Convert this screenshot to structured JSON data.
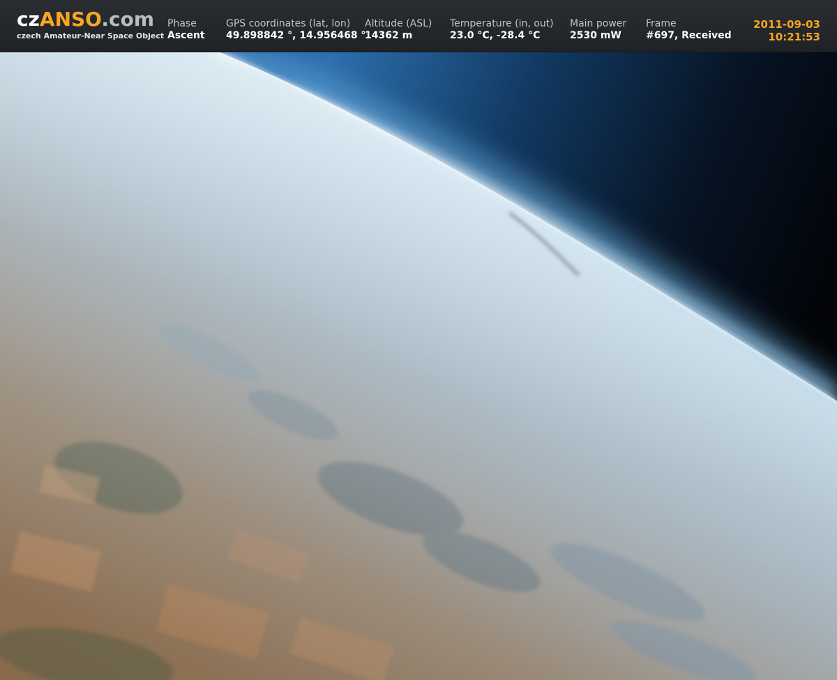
{
  "logo": {
    "part1": "cz",
    "part2": "ANSO",
    "part3": ".com",
    "subtitle": "czech Amateur-Near Space Object"
  },
  "telemetry": {
    "phase": {
      "label": "Phase",
      "value": "Ascent"
    },
    "gps": {
      "label": "GPS coordinates (lat, lon)",
      "value": "49.898842 °, 14.956468 °"
    },
    "altitude": {
      "label": "Altitude (ASL)",
      "value": "14362 m"
    },
    "temperature": {
      "label": "Temperature (in, out)",
      "value": "23.0 °C, -28.4 °C"
    },
    "power": {
      "label": "Main power",
      "value": "2530 mW"
    },
    "frame": {
      "label": "Frame",
      "value": "#697, Received"
    }
  },
  "datetime": {
    "date": "2011-09-03",
    "time": "10:21:53"
  },
  "colors": {
    "accent": "#f5a623",
    "bar_background": "#25282c",
    "space": "#05080e",
    "sky_blue": "#3f8fd0"
  }
}
